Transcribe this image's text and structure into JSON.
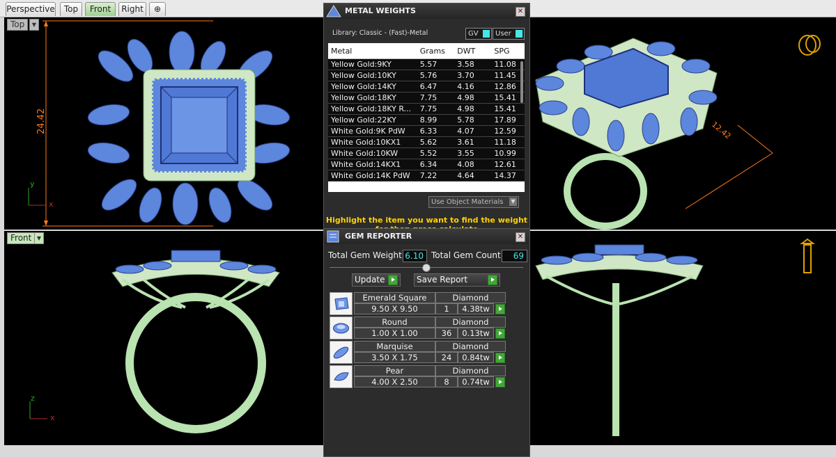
{
  "tabs": [
    {
      "label": "Perspective"
    },
    {
      "label": "Top"
    },
    {
      "label": "Front"
    },
    {
      "label": "Right"
    },
    {
      "label": "⊕"
    }
  ],
  "viewports": {
    "top": "Top",
    "front": "Front"
  },
  "dimensions": {
    "top_height": "24.42",
    "right_offset": "12.42"
  },
  "axes": {
    "x": "x",
    "y": "y",
    "z": "z"
  },
  "metal_weights": {
    "title": "METAL WEIGHTS",
    "library": "Library: Classic - (Fast)-Metal",
    "gv_label": "GV",
    "user_label": "User",
    "columns": [
      "Metal",
      "Grams",
      "DWT",
      "SPG"
    ],
    "rows": [
      [
        "Yellow Gold:9KY",
        "5.57",
        "3.58",
        "11.08"
      ],
      [
        "Yellow Gold:10KY",
        "5.76",
        "3.70",
        "11.45"
      ],
      [
        "Yellow Gold:14KY",
        "6.47",
        "4.16",
        "12.86"
      ],
      [
        "Yellow Gold:18KY",
        "7.75",
        "4.98",
        "15.41"
      ],
      [
        "Yellow Gold:18KY R...",
        "7.75",
        "4.98",
        "15.41"
      ],
      [
        "Yellow Gold:22KY",
        "8.99",
        "5.78",
        "17.89"
      ],
      [
        "White Gold:9K PdW",
        "6.33",
        "4.07",
        "12.59"
      ],
      [
        "White Gold:10KX1",
        "5.62",
        "3.61",
        "11.18"
      ],
      [
        "White Gold:10KW",
        "5.52",
        "3.55",
        "10.99"
      ],
      [
        "White Gold:14KX1",
        "6.34",
        "4.08",
        "12.61"
      ],
      [
        "White Gold:14K PdW",
        "7.22",
        "4.64",
        "14.37"
      ]
    ],
    "use_object_materials": "Use Object Materials",
    "highlight_line1": "Highlight the item you want to find the weight",
    "highlight_line2": "for then press calculate"
  },
  "gem_reporter": {
    "title": "GEM REPORTER",
    "total_weight_label": "Total Gem Weight",
    "total_weight": "6.10",
    "total_count_label": "Total Gem Count",
    "total_count": "69",
    "update_label": "Update",
    "save_label": "Save Report",
    "gems": [
      {
        "shape": "Emerald Square",
        "size": "9.50 X 9.50",
        "material": "Diamond",
        "count": "1",
        "weight": "4.38tw"
      },
      {
        "shape": "Round",
        "size": "1.00 X 1.00",
        "material": "Diamond",
        "count": "36",
        "weight": "0.13tw"
      },
      {
        "shape": "Marquise",
        "size": "3.50 X 1.75",
        "material": "Diamond",
        "count": "24",
        "weight": "0.84tw"
      },
      {
        "shape": "Pear",
        "size": "4.00 X 2.50",
        "material": "Diamond",
        "count": "8",
        "weight": "0.74tw"
      }
    ]
  },
  "colors": {
    "gem_blue": "#5d86dd",
    "metal_green": "#b9e3b0",
    "dimension_orange": "#ff7a1a",
    "accent_cyan": "#46e6e6",
    "highlight_yellow": "#ffd200"
  }
}
